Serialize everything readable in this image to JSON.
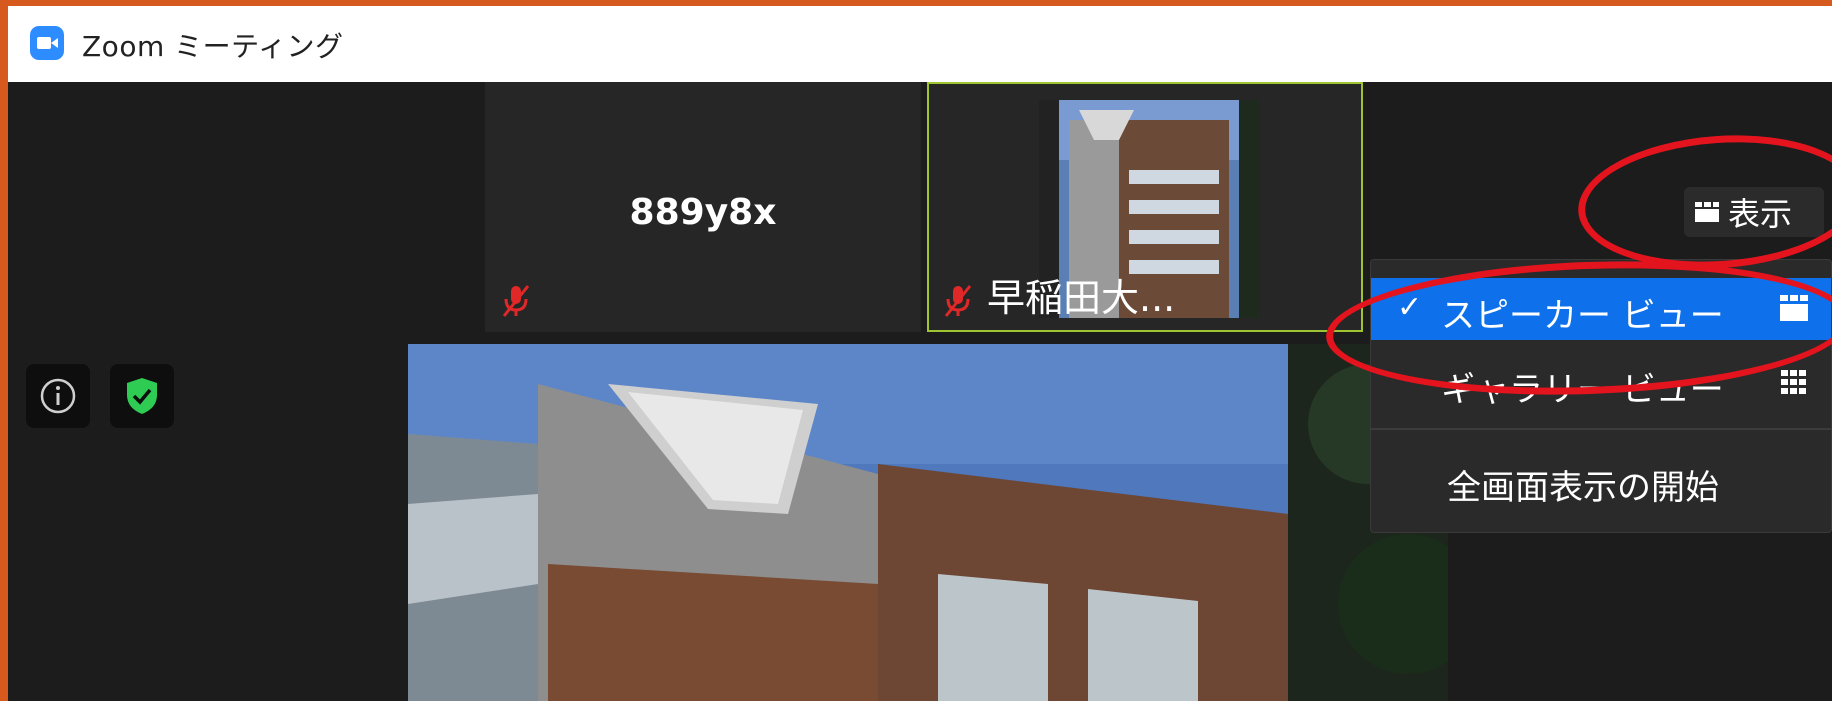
{
  "window": {
    "title": "Zoom ミーティング"
  },
  "thumbnails": [
    {
      "name": "889y8x",
      "muted": true
    },
    {
      "name": "早稲田大...",
      "muted": true,
      "active_speaker": true
    }
  ],
  "toolbar": {
    "view_button_label": "表示"
  },
  "view_menu": {
    "items": [
      {
        "label": "スピーカー ビュー",
        "checked": true,
        "icon": "speaker-view-icon"
      },
      {
        "label": "ギャラリー ビュー",
        "checked": false,
        "icon": "gallery-view-icon"
      },
      {
        "label": "全画面表示の開始",
        "checked": false
      }
    ]
  },
  "colors": {
    "accent": "#0e71eb",
    "zoom_blue": "#2d8cff",
    "annotation": "#e3141d",
    "speaker_border": "#9ec431"
  }
}
